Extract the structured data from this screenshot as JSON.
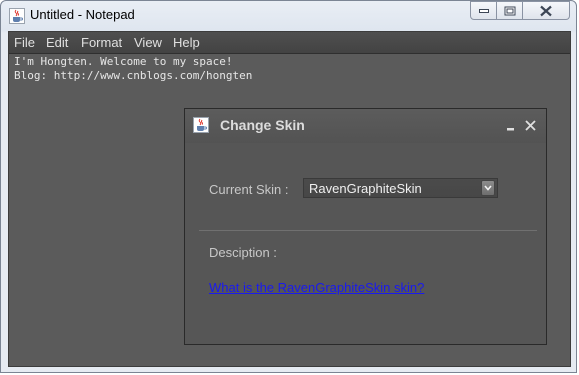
{
  "window": {
    "title": "Untitled - Notepad",
    "icon": "java-cup-icon"
  },
  "menu": [
    "File",
    "Edit",
    "Format",
    "View",
    "Help"
  ],
  "editor": {
    "lines": [
      "I'm Hongten. Welcome to my space!",
      "Blog: http://www.cnblogs.com/hongten"
    ]
  },
  "dialog": {
    "title": "Change Skin",
    "icon": "java-cup-icon",
    "current_skin_label": "Current Skin :",
    "current_skin_value": "RavenGraphiteSkin",
    "description_label": "Desciption :",
    "link_text": "What is the RavenGraphiteSkin skin?"
  },
  "colors": {
    "skin_background": "#5a5a5a",
    "dialog_background": "#565656",
    "link": "#1a1aee"
  }
}
